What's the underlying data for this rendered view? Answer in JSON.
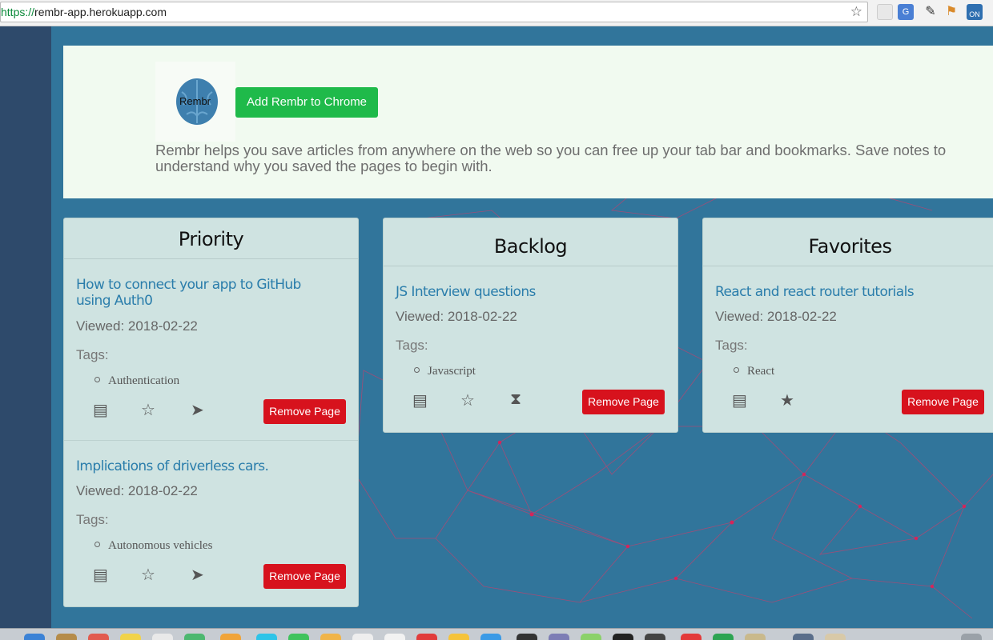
{
  "browser": {
    "url_scheme": "https://",
    "url_host": "rembr-app.herokuapp.com",
    "extensions": [
      "bookmark-icon",
      "translate-icon",
      "eyedropper-icon",
      "ruler-icon",
      "on-badge-icon"
    ],
    "on_badge": "ON"
  },
  "hero": {
    "logo_text": "Rembr",
    "add_button": "Add Rembr to Chrome",
    "description": "Rembr helps you save articles from anywhere on the web so you can free up your tab bar and bookmarks. Save notes to understand why you saved the pages to begin with."
  },
  "columns": [
    {
      "title": "Priority",
      "cards": [
        {
          "title": "How to connect your app to GitHub using Auth0",
          "viewed": "Viewed: 2018-02-22",
          "tags_label": "Tags:",
          "tags": [
            "Authentication"
          ],
          "remove_label": "Remove Page"
        },
        {
          "title": "Implications of driverless cars.",
          "viewed": "Viewed: 2018-02-22",
          "tags_label": "Tags:",
          "tags": [
            "Autonomous vehicles"
          ],
          "remove_label": "Remove Page"
        }
      ]
    },
    {
      "title": "Backlog",
      "cards": [
        {
          "title": "JS Interview questions",
          "viewed": "Viewed: 2018-02-22",
          "tags_label": "Tags:",
          "tags": [
            "Javascript"
          ],
          "remove_label": "Remove Page"
        }
      ]
    },
    {
      "title": "Favorites",
      "cards": [
        {
          "title": "React and react router tutorials",
          "viewed": "Viewed: 2018-02-22",
          "tags_label": "Tags:",
          "tags": [
            "React"
          ],
          "remove_label": "Remove Page"
        }
      ]
    }
  ],
  "colors": {
    "page_background": "#31759b",
    "add_button": "#1fba4a",
    "remove_button": "#d7121d",
    "link": "#2a7dab",
    "panel": "#cfe3e1"
  }
}
